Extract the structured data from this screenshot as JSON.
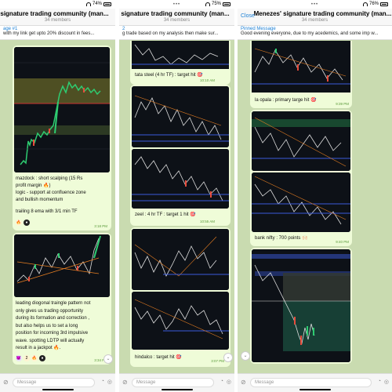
{
  "panels": [
    {
      "status": {
        "battery": "74%"
      },
      "header": {
        "title": "signature trading community (man...",
        "subtitle": "34 members"
      },
      "pinned": {
        "label": "age #1",
        "text": "with my link get upto 20% discount in fees..."
      },
      "messages": [
        {
          "text_lines": [
            "mazdock : short scalping (15 Rs",
            "profit margin 🔥)",
            "logic - support at confluence zone",
            "and bullish momentum",
            "",
            "trailing 8 ema with 3/1 min TF"
          ],
          "time": "3:18 PM"
        },
        {
          "text_lines": [
            "leading diogonal traingle pattern not",
            "only gives us trading opportunity",
            "during its formation and correction ,",
            "but also helps us to set a long",
            "position for incoming 3rd impulsive",
            "wave. spotting LDTP will actually",
            "result in a jackpot 🔥."
          ],
          "time": "3:34 PM"
        }
      ],
      "input_placeholder": "Message"
    },
    {
      "status": {
        "battery": "75%"
      },
      "header": {
        "title": "signature trading community (man...",
        "subtitle": "34 members"
      },
      "pinned": {
        "label": "2",
        "text": "g trade based on my analysis then make sur..."
      },
      "messages": [
        {
          "text_lines": [
            "tata steel (4 hr TF) : target hit 🎯"
          ],
          "time": "10:10 AM"
        },
        {
          "text_lines": [
            "zeel : 4 hr TF : target 1 hit 🎯"
          ],
          "time": "10:55 AM"
        },
        {
          "text_lines": [
            "hindalco : target hit 🎯"
          ],
          "time": "3:07 PM"
        }
      ],
      "input_placeholder": "Message"
    },
    {
      "status": {
        "battery": "76%"
      },
      "header": {
        "title": "Menezes' signature trading community (man...",
        "subtitle": "34 members",
        "close": "Close"
      },
      "pinned": {
        "label": "Pinned Message",
        "text": "Good evening everyone, due to my acedemics, and some imp w..."
      },
      "messages": [
        {
          "text_lines": [
            "la opala : primary targe hit 🎯"
          ],
          "time": "9:39 PM"
        },
        {
          "text_lines": [
            "bank nifty : 700 points 🙌🏻"
          ],
          "time": "9:40 PM"
        }
      ],
      "input_placeholder": "Message"
    }
  ],
  "colors": {
    "chat_bg": "#c9dbb0",
    "bubble": "#effcd8",
    "link": "#1a7fd4",
    "chart_bg": "#0d1117",
    "time": "#5a9a3a"
  }
}
